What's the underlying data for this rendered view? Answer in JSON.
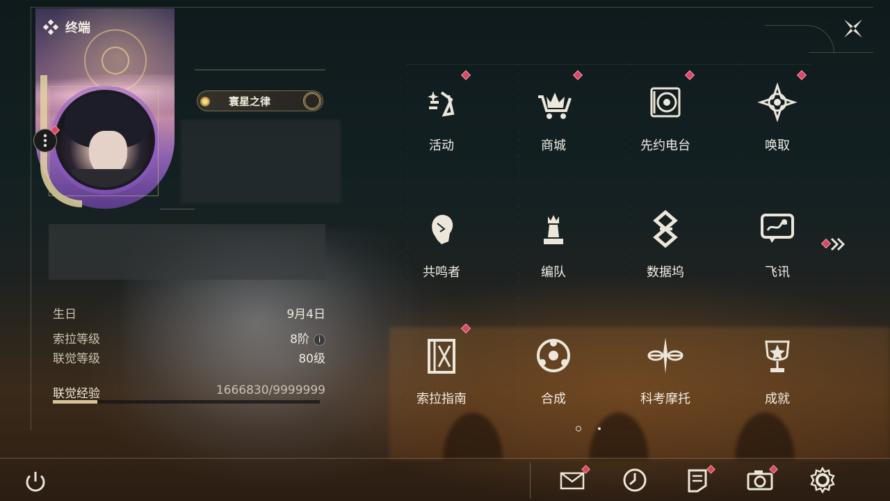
{
  "header": {
    "title": "终端"
  },
  "profile": {
    "title_badge": "寰星之律",
    "info": [
      {
        "label": "生日",
        "value": "9月4日"
      },
      {
        "label": "索拉等级",
        "value": "8阶"
      },
      {
        "label": "联觉等级",
        "value": "80级"
      }
    ],
    "exp": {
      "label": "联觉经验",
      "value": "1666830/9999999",
      "progress": 0.1667
    }
  },
  "menu": [
    {
      "label": "活动",
      "icon": "activity-icon",
      "badge": true
    },
    {
      "label": "商城",
      "icon": "shop-icon",
      "badge": true
    },
    {
      "label": "先约电台",
      "icon": "radio-icon",
      "badge": true
    },
    {
      "label": "唤取",
      "icon": "convene-icon",
      "badge": true
    },
    {
      "label": "共鸣者",
      "icon": "resonator-icon",
      "badge": false
    },
    {
      "label": "编队",
      "icon": "team-icon",
      "badge": false
    },
    {
      "label": "数据坞",
      "icon": "data-bank-icon",
      "badge": false
    },
    {
      "label": "飞讯",
      "icon": "message-icon",
      "badge": false
    },
    {
      "label": "索拉指南",
      "icon": "guidebook-icon",
      "badge": true
    },
    {
      "label": "合成",
      "icon": "synthesis-icon",
      "badge": false
    },
    {
      "label": "科考摩托",
      "icon": "motorbike-icon",
      "badge": false
    },
    {
      "label": "成就",
      "icon": "achievement-icon",
      "badge": false
    }
  ],
  "bottom_bar": [
    {
      "icon": "mail-icon",
      "badge": true
    },
    {
      "icon": "clock-icon",
      "badge": false
    },
    {
      "icon": "notice-icon",
      "badge": true
    },
    {
      "icon": "camera-icon",
      "badge": true
    },
    {
      "icon": "settings-icon",
      "badge": false
    }
  ],
  "pagination": {
    "current": 1,
    "total": 2
  },
  "colors": {
    "accent_gold": "#d7c497",
    "badge_red": "#d9485f",
    "text_primary": "#f2eee4"
  }
}
